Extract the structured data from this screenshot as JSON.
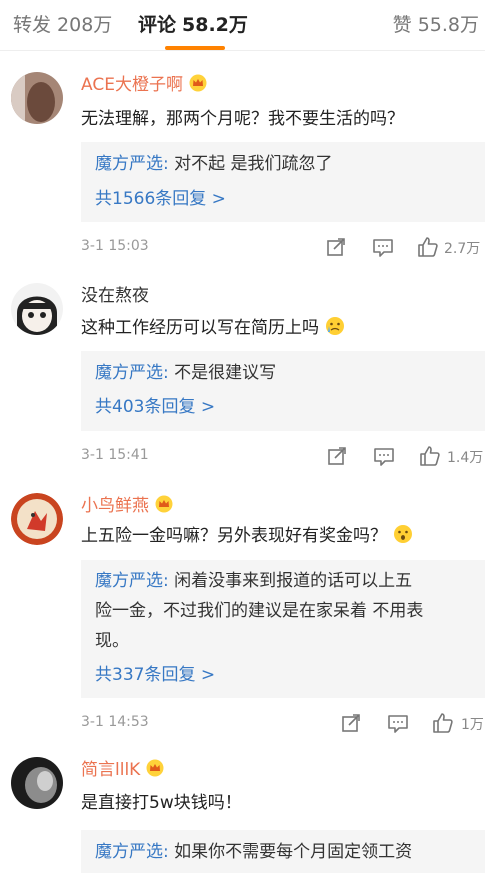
{
  "tabs": {
    "repost": {
      "label": "转发",
      "count": "208万"
    },
    "comments": {
      "label": "评论",
      "count": "58.2万"
    },
    "likes": {
      "label": "赞",
      "count": "55.8万"
    }
  },
  "accent_color": "#ff8200",
  "icons": {
    "share": "share-icon",
    "comment": "comment-icon",
    "like": "thumbs-up-icon",
    "vip": "crown-badge-icon"
  },
  "comments": [
    {
      "username": "ACE大橙子啊",
      "text": "无法理解，那两个月呢？我不要生活的吗？",
      "reply_author": "魔方严选:",
      "reply_text": " 对不起 是我们疏忽了",
      "reply_more": "共1566条回复 >",
      "time": "3-1 15:03",
      "likes": "2.7万"
    },
    {
      "username": "没在熬夜",
      "text": "这种工作经历可以写在简历上吗",
      "reply_author": "魔方严选:",
      "reply_text": " 不是很建议写",
      "reply_more": "共403条回复 >",
      "time": "3-1 15:41",
      "likes": "1.4万"
    },
    {
      "username": "小鸟鲜燕",
      "text": "上五险一金吗嘛？另外表现好有奖金吗？",
      "reply_author": "魔方严选:",
      "reply_lines": [
        " 闲着没事来到报道的话可以上五",
        "险一金，不过我们的建议是在家呆着 不用表",
        "现。"
      ],
      "reply_more": "共337条回复 >",
      "time": "3-1 14:53",
      "likes": "1万"
    },
    {
      "username": "简言lllK",
      "text": "是直接打5w块钱吗！",
      "reply_author": "魔方严选:",
      "reply_text": " 如果你不需要每个月固定领工资"
    }
  ]
}
